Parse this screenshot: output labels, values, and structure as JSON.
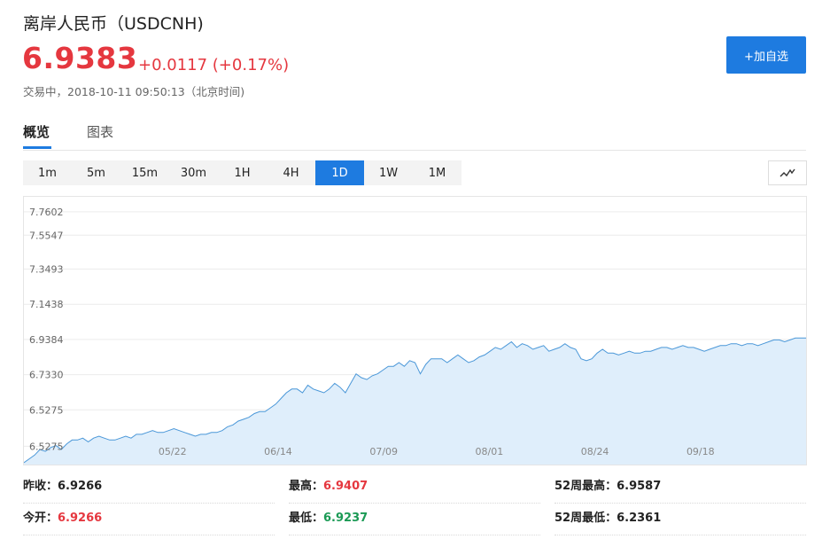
{
  "header": {
    "title": "离岸人民币（USDCNH)",
    "price": "6.9383",
    "change": "+0.0117 (+0.17%)",
    "status": "交易中，2018-10-11 09:50:13（北京时间)",
    "watch_button": "+加自选"
  },
  "tabs": [
    "概览",
    "图表"
  ],
  "ranges": {
    "items": [
      "1m",
      "5m",
      "15m",
      "30m",
      "1H",
      "4H",
      "1D",
      "1W",
      "1M"
    ],
    "active": "1D"
  },
  "colors": {
    "accent": "#1e7be0",
    "up": "#e5373f",
    "down": "#1b9a55",
    "line": "#4a97d8",
    "fill": "#dfeefb"
  },
  "chart_data": {
    "type": "area",
    "ylim": [
      6.42,
      7.8
    ],
    "y_ticks": [
      "7.7602",
      "7.5547",
      "7.3493",
      "7.1438",
      "6.9384",
      "6.7330",
      "6.5275",
      "6.5275"
    ],
    "x_ticks": [
      "05/22",
      "06/14",
      "07/09",
      "08/01",
      "08/24",
      "09/18"
    ],
    "grid": true,
    "values": [
      6.43,
      6.45,
      6.47,
      6.5,
      6.49,
      6.51,
      6.52,
      6.5,
      6.53,
      6.55,
      6.55,
      6.56,
      6.54,
      6.56,
      6.57,
      6.56,
      6.55,
      6.55,
      6.56,
      6.57,
      6.56,
      6.58,
      6.58,
      6.59,
      6.6,
      6.59,
      6.59,
      6.6,
      6.61,
      6.6,
      6.59,
      6.58,
      6.57,
      6.58,
      6.58,
      6.59,
      6.59,
      6.6,
      6.62,
      6.63,
      6.65,
      6.66,
      6.67,
      6.69,
      6.7,
      6.7,
      6.72,
      6.74,
      6.77,
      6.8,
      6.82,
      6.82,
      6.8,
      6.84,
      6.82,
      6.81,
      6.8,
      6.82,
      6.85,
      6.83,
      6.8,
      6.85,
      6.9,
      6.88,
      6.87,
      6.89,
      6.9,
      6.92,
      6.94,
      6.94,
      6.96,
      6.94,
      6.97,
      6.96,
      6.9,
      6.95,
      6.98,
      6.98,
      6.98,
      6.96,
      6.98,
      7.0,
      6.98,
      6.96,
      6.97,
      6.99,
      7.0,
      7.02,
      7.04,
      7.03,
      7.05,
      7.07,
      7.04,
      7.06,
      7.05,
      7.03,
      7.04,
      7.05,
      7.02,
      7.03,
      7.04,
      7.06,
      7.04,
      7.03,
      6.98,
      6.97,
      6.98,
      7.01,
      7.03,
      7.01,
      7.01,
      7.0,
      7.01,
      7.02,
      7.01,
      7.01,
      7.02,
      7.02,
      7.03,
      7.04,
      7.04,
      7.03,
      7.04,
      7.05,
      7.04,
      7.04,
      7.03,
      7.02,
      7.03,
      7.04,
      7.05,
      7.05,
      7.06,
      7.06,
      7.05,
      7.06,
      7.06,
      7.05,
      7.06,
      7.07,
      7.08,
      7.08,
      7.07,
      7.08,
      7.09,
      7.09,
      7.09
    ]
  },
  "stats": {
    "prev_close_label": "昨收：",
    "prev_close": "6.9266",
    "open_label": "今开：",
    "open": "6.9266",
    "high_label": "最高：",
    "high": "6.9407",
    "low_label": "最低：",
    "low": "6.9237",
    "high52_label": "52周最高：",
    "high52": "6.9587",
    "low52_label": "52周最低：",
    "low52": "6.2361"
  }
}
